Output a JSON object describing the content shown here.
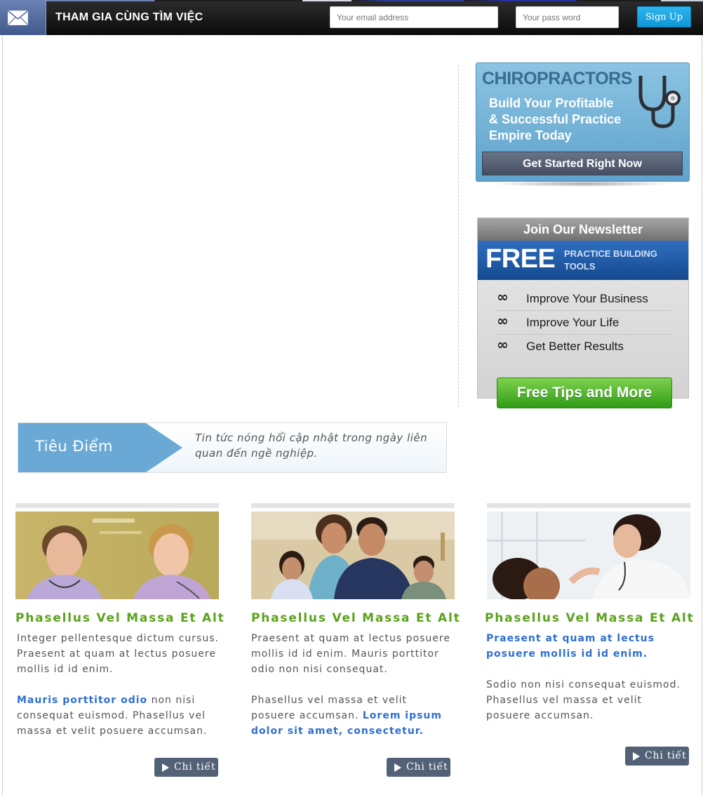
{
  "topbar": {
    "title": "THAM GIA CÙNG TÌM VIỆC",
    "email_placeholder": "Your email address",
    "password_placeholder": "Your pass word",
    "signup_label": "Sign Up",
    "icon": "mail-icon"
  },
  "ads": {
    "chiro": {
      "title": "CHIROPRACTORS",
      "lines": [
        "Build Your Profitable",
        "& Successful Practice",
        "Empire Today"
      ],
      "button": "Get Started Right Now",
      "icon": "stethoscope-icon"
    },
    "newsletter": {
      "header": "Join Our Newsletter",
      "free": "FREE",
      "tools": "PRACTICE BUILDING TOOLS",
      "items": [
        "Improve Your Business",
        "Improve Your Life",
        "Get Better Results"
      ],
      "bullet": "∞",
      "button": "Free Tips and More"
    }
  },
  "focus": {
    "title": "Tiêu Điểm",
    "text": "Tin tức nóng hổi cập nhật trong ngày liên quan đến ngề nghiệp."
  },
  "cards": [
    {
      "title": "Phasellus Vel Massa Et Alt",
      "p1": "Integer pellentesque dictum cursus. Praesent at quam at lectus posuere mollis id id enim.",
      "p2_blue": "Mauris porttitor odio",
      "p2_rest": " non nisi consequat euismod. Phasellus vel massa et velit posuere accumsan.",
      "button": "Chi tiết"
    },
    {
      "title": "Phasellus Vel Massa Et Alt",
      "p1": "Praesent at quam at lectus posuere mollis id id enim. Mauris porttitor odio non nisi consequat.",
      "p2_rest": "Phasellus vel massa et velit posuere accumsan. ",
      "p2_blue": "Lorem ipsum dolor sit amet, consectetur.",
      "button": "Chi tiết"
    },
    {
      "title": "Phasellus Vel Massa Et Alt",
      "p1_blue": "Praesent at quam at lectus posuere mollis id id enim.",
      "p2": "Sodio non nisi consequat euismod. Phasellus vel massa et velit posuere accumsan.",
      "button": "Chi tiết"
    }
  ],
  "colors": {
    "accent_green": "#5aa21b",
    "link_blue": "#2e6fd0",
    "signup_blue": "#1aa3e2",
    "focus_blue": "#6aa9d6"
  }
}
